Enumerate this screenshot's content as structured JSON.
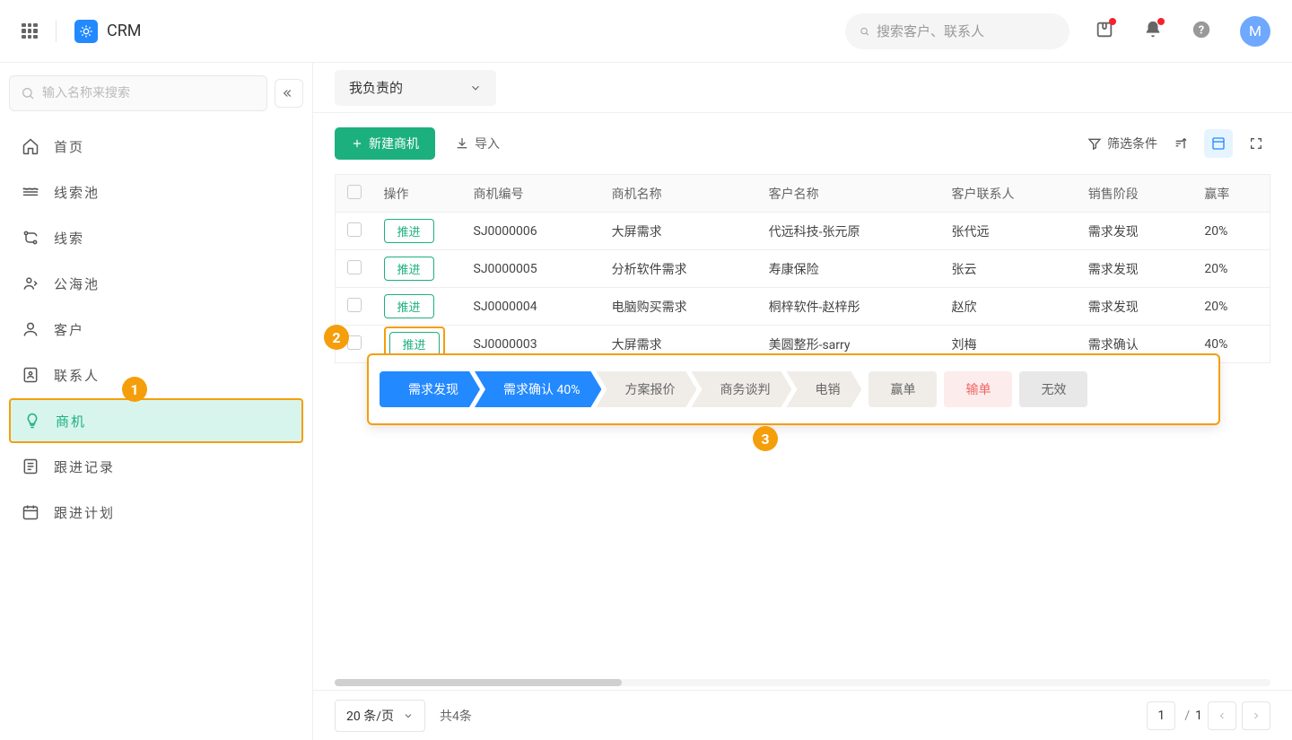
{
  "header": {
    "app_name": "CRM",
    "search_placeholder": "搜索客户、联系人",
    "avatar_initial": "M"
  },
  "sidebar": {
    "search_placeholder": "输入名称来搜索",
    "items": [
      {
        "icon": "home",
        "label": "首页"
      },
      {
        "icon": "layers",
        "label": "线索池"
      },
      {
        "icon": "route",
        "label": "线索"
      },
      {
        "icon": "pool",
        "label": "公海池"
      },
      {
        "icon": "user",
        "label": "客户"
      },
      {
        "icon": "contact",
        "label": "联系人"
      },
      {
        "icon": "bulb",
        "label": "商机"
      },
      {
        "icon": "note",
        "label": "跟进记录"
      },
      {
        "icon": "calendar",
        "label": "跟进计划"
      }
    ],
    "active_index": 6
  },
  "scope": {
    "label": "我负责的"
  },
  "toolbar": {
    "new_label": "新建商机",
    "import_label": "导入",
    "filter_label": "筛选条件"
  },
  "table": {
    "columns": [
      "操作",
      "商机编号",
      "商机名称",
      "客户名称",
      "客户联系人",
      "销售阶段",
      "赢率"
    ],
    "action_label": "推进",
    "rows": [
      {
        "id": "SJ0000006",
        "name": "大屏需求",
        "customer": "代远科技-张元原",
        "contact": "张代远",
        "stage": "需求发现",
        "rate": "20%"
      },
      {
        "id": "SJ0000005",
        "name": "分析软件需求",
        "customer": "寿康保险",
        "contact": "张云",
        "stage": "需求发现",
        "rate": "20%"
      },
      {
        "id": "SJ0000004",
        "name": "电脑购买需求",
        "customer": "桐梓软件-赵梓彤",
        "contact": "赵欣",
        "stage": "需求发现",
        "rate": "20%"
      },
      {
        "id": "SJ0000003",
        "name": "大屏需求",
        "customer": "美圆整形-sarry",
        "contact": "刘梅",
        "stage": "需求确认",
        "rate": "40%"
      }
    ]
  },
  "stages": {
    "steps": [
      "需求发现",
      "需求确认 40%",
      "方案报价",
      "商务谈判",
      "电销"
    ],
    "current_index": 1,
    "win": "赢单",
    "lose": "输单",
    "void": "无效"
  },
  "callouts": {
    "one": "1",
    "two": "2",
    "three": "3"
  },
  "footer": {
    "page_size": "20 条/页",
    "total": "共4条",
    "current_page": "1",
    "total_pages": "1",
    "sep": "/"
  }
}
